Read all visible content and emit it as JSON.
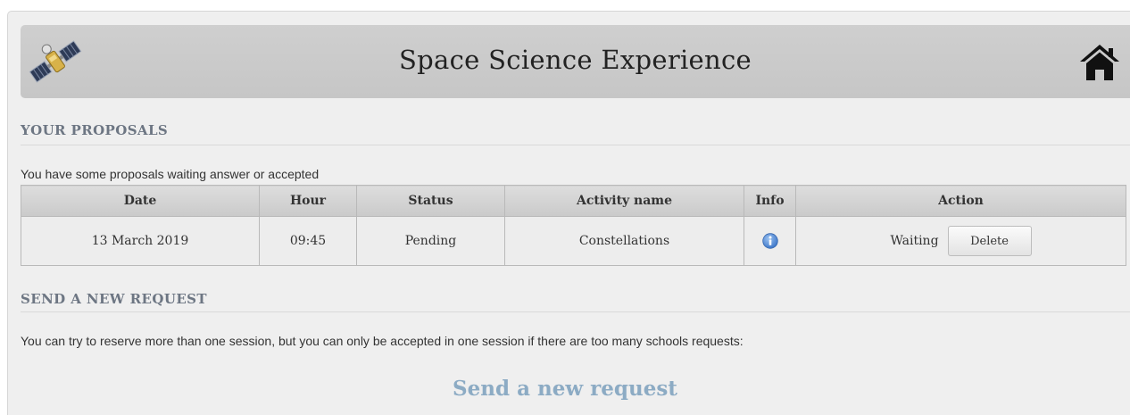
{
  "header": {
    "title": "Space Science Experience",
    "logo_icon": "satellite-icon",
    "home_icon": "home-icon"
  },
  "proposals": {
    "heading": "YOUR PROPOSALS",
    "intro": "You have some proposals waiting answer or accepted",
    "columns": [
      "Date",
      "Hour",
      "Status",
      "Activity name",
      "Info",
      "Action"
    ],
    "rows": [
      {
        "date": "13 March 2019",
        "hour": "09:45",
        "status": "Pending",
        "activity": "Constellations",
        "info_icon": "info-icon",
        "action_status": "Waiting",
        "delete_label": "Delete"
      }
    ]
  },
  "new_request": {
    "heading": "SEND A NEW REQUEST",
    "description": "You can try to reserve more than one session, but you can only be accepted in one session if there are too many schools requests:",
    "link_label": "Send a new request"
  },
  "colors": {
    "heading_text": "#6d7683",
    "link": "#8cabc4",
    "info_icon": "#5b8fd6",
    "panel_bg": "#efefef",
    "header_bg": "#c9c9c9"
  }
}
